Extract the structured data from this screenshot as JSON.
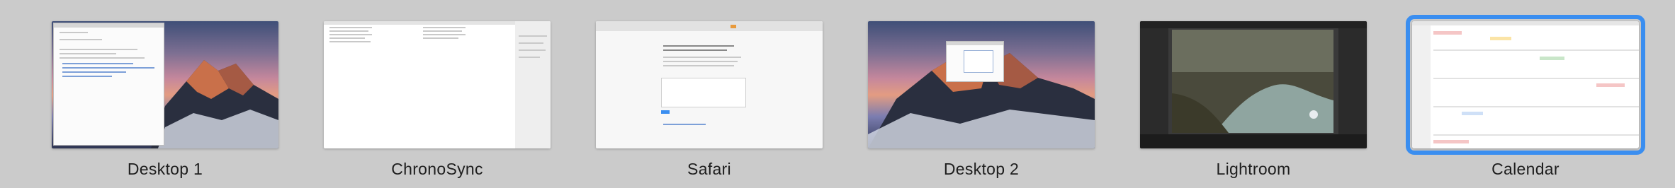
{
  "spaces": [
    {
      "label": "Desktop 1",
      "selected": false
    },
    {
      "label": "ChronoSync",
      "selected": false
    },
    {
      "label": "Safari",
      "selected": false
    },
    {
      "label": "Desktop 2",
      "selected": false
    },
    {
      "label": "Lightroom",
      "selected": false
    },
    {
      "label": "Calendar",
      "selected": true
    }
  ],
  "colors": {
    "background": "#cbcbcb",
    "selection_outline": "#3a8ef0",
    "label_text": "#1e1e1e"
  }
}
